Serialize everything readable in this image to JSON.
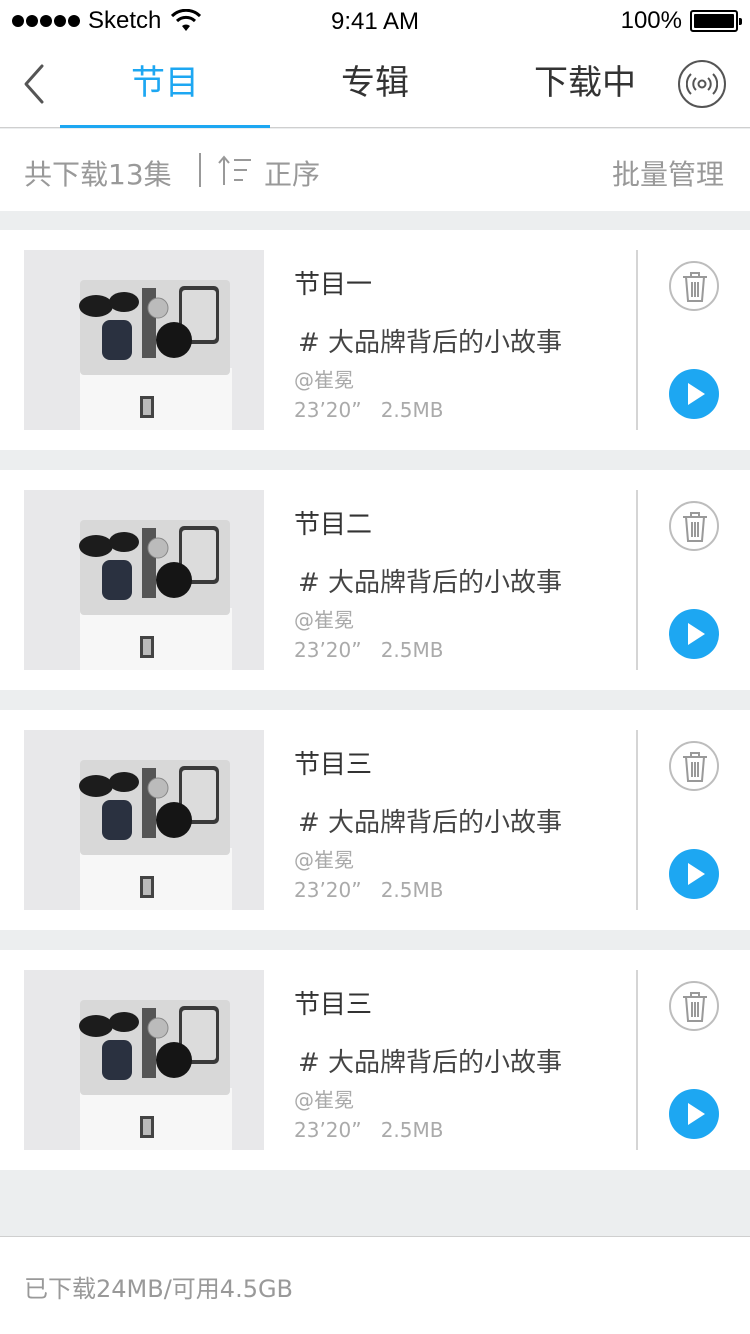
{
  "status_bar": {
    "carrier": "Sketch",
    "time": "9:41 AM",
    "battery": "100%",
    "battery_level": 1.0
  },
  "nav": {
    "tabs": [
      {
        "label": "节目",
        "active": true
      },
      {
        "label": "专辑",
        "active": false
      },
      {
        "label": "下载中",
        "active": false
      }
    ],
    "back_icon": "chevron-left-icon",
    "broadcast_icon": "broadcast-icon"
  },
  "toolbar": {
    "total": "共下载13集",
    "sort_label": "正序",
    "batch_label": "批量管理"
  },
  "items": [
    {
      "title": "节目一",
      "subtitle": "# 大品牌背后的小故事",
      "author": "@崔冕",
      "duration": "23’20”",
      "size": "2.5MB"
    },
    {
      "title": "节目二",
      "subtitle": "# 大品牌背后的小故事",
      "author": "@崔冕",
      "duration": "23’20”",
      "size": "2.5MB"
    },
    {
      "title": "节目三",
      "subtitle": "# 大品牌背后的小故事",
      "author": "@崔冕",
      "duration": "23’20”",
      "size": "2.5MB"
    },
    {
      "title": "节目三",
      "subtitle": "# 大品牌背后的小故事",
      "author": "@崔冕",
      "duration": "23’20”",
      "size": "2.5MB"
    }
  ],
  "footer": {
    "storage": "已下载24MB/可用4.5GB"
  },
  "colors": {
    "accent": "#1da7f2",
    "background": "#eceeef",
    "muted_text": "#999999"
  }
}
